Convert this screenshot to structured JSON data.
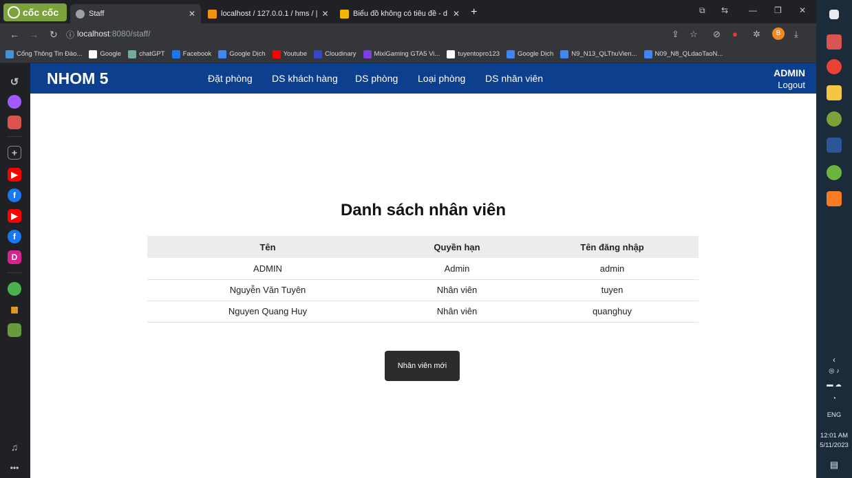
{
  "browser": {
    "brand": "cốc cốc",
    "tabs": [
      {
        "title": "Staff"
      },
      {
        "title": "localhost / 127.0.0.1 / hms / |"
      },
      {
        "title": "Biểu đồ không có tiêu đề - d"
      }
    ],
    "url_host": "localhost",
    "url_rest": ":8080/staff/",
    "bookmarks": [
      {
        "label": "Cổng Thông Tin Đào...",
        "color": "#4a90d9"
      },
      {
        "label": "Google",
        "color": "#ffffff"
      },
      {
        "label": "chatGPT",
        "color": "#74aa9c"
      },
      {
        "label": "Facebook",
        "color": "#1877f2"
      },
      {
        "label": "Google Dịch",
        "color": "#4285f4"
      },
      {
        "label": "Youtube",
        "color": "#ff0000"
      },
      {
        "label": "Cloudinary",
        "color": "#3448c5"
      },
      {
        "label": "MixiGaming GTA5 Vi...",
        "color": "#7b3fe4"
      },
      {
        "label": "tuyentopro123",
        "color": "#ffffff"
      },
      {
        "label": "Google Dịch",
        "color": "#4285f4"
      },
      {
        "label": "N9_N13_QLThuVien...",
        "color": "#4285f4"
      },
      {
        "label": "N09_N8_QLdaoTaoN...",
        "color": "#4285f4"
      }
    ],
    "profile_initial": "B"
  },
  "navbar": {
    "brand": "NHOM 5",
    "links": [
      "Đặt phòng",
      "DS khách hàng",
      "DS phòng",
      "Loại phòng",
      "DS nhân viên"
    ],
    "user": "ADMIN",
    "logout": "Logout"
  },
  "main": {
    "heading": "Danh sách nhân viên",
    "columns": [
      "Tên",
      "Quyền hạn",
      "Tên đăng nhập"
    ],
    "rows": [
      [
        "ADMIN",
        "Admin",
        "admin"
      ],
      [
        "Nguyễn Văn Tuyên",
        "Nhân viên",
        "tuyen"
      ],
      [
        "Nguyen Quang Huy",
        "Nhân viên",
        "quanghuy"
      ]
    ],
    "new_button": "Nhân viên mới"
  },
  "taskbar": {
    "lang": "ENG",
    "time": "12:01 AM",
    "date": "5/11/2023"
  },
  "colors": {
    "navbar": "#0d3f8f",
    "button": "#2c2c2c",
    "header_row": "#ececec"
  }
}
